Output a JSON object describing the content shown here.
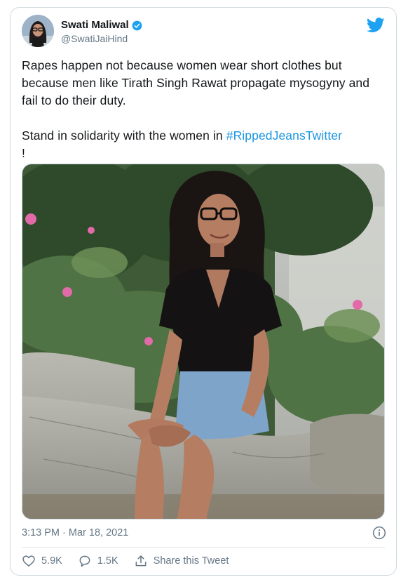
{
  "author": {
    "display_name": "Swati Maliwal",
    "handle": "@SwatiJaiHind"
  },
  "tweet": {
    "line1": "Rapes happen not because women wear short clothes but because men like Tirath Singh Rawat propagate mysogyny and fail to do their duty.",
    "line2_prefix": "Stand in solidarity with the women in ",
    "hashtag": "#RippedJeansTwitter",
    "line2_suffix": "!"
  },
  "timestamp": "3:13 PM · Mar 18, 2021",
  "actions": {
    "likes": "5.9K",
    "replies": "1.5K",
    "share_label": "Share this Tweet"
  },
  "colors": {
    "accent": "#1b95e0",
    "verified": "#1da1f2",
    "muted": "#657786",
    "border": "#cfd9de"
  },
  "icons": [
    "twitter-logo-icon",
    "verified-badge-icon",
    "info-icon",
    "heart-icon",
    "reply-icon",
    "share-icon"
  ]
}
